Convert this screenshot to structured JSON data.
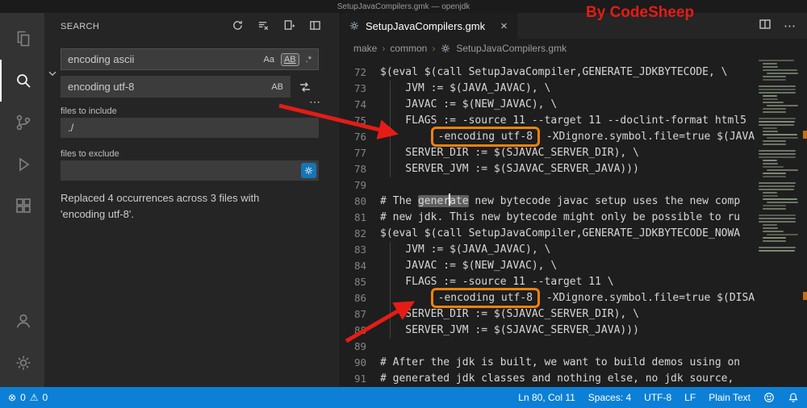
{
  "colors": {
    "statusbar_blue": "#0c80d7",
    "annotation_orange": "#ec820e",
    "annotation_red": "#e51c16",
    "activity_bar_bg": "#333333",
    "sidebar_bg": "#252526",
    "editor_bg": "#1e1e1e",
    "accent_blue": "#1476b5"
  },
  "glyphs": {
    "match_case": "Aa",
    "whole_word": "AB",
    "regex": ".*",
    "preserve_case": "AB",
    "more": "⋯",
    "breadcrumb_sep": "›",
    "close": "×",
    "errors_icon": "⊗",
    "warnings_icon": "⚠"
  },
  "title_bar": {
    "title": "SetupJavaCompilers.gmk — openjdk",
    "watermark": "By CodeSheep"
  },
  "activity_bar": {
    "items": [
      "explorer",
      "search",
      "source-control",
      "run-and-debug",
      "extensions"
    ],
    "active": "search",
    "bottom_items": [
      "account",
      "settings"
    ]
  },
  "search_panel": {
    "title": "SEARCH",
    "header_icons": [
      "refresh",
      "clear-search-results",
      "open-new-search-editor",
      "open-search-in-editor"
    ],
    "search": {
      "value": "encoding ascii"
    },
    "replace": {
      "value": "encoding utf-8"
    },
    "files_to_include": {
      "label": "files to include",
      "value": "./"
    },
    "files_to_exclude": {
      "label": "files to exclude",
      "value": ""
    },
    "message": "Replaced 4 occurrences across 3 files with 'encoding utf-8'."
  },
  "editor": {
    "tab": {
      "label": "SetupJavaCompilers.gmk"
    },
    "breadcrumbs": [
      "make",
      "common",
      "SetupJavaCompilers.gmk"
    ],
    "code": {
      "lines": [
        {
          "n": 72,
          "t": "$(eval $(call SetupJavaCompiler,GENERATE_JDKBYTECODE, \\"
        },
        {
          "n": 73,
          "t": "    JVM := $(JAVA_JAVAC), \\",
          "guide": true
        },
        {
          "n": 74,
          "t": "    JAVAC := $(NEW_JAVAC), \\",
          "guide": true
        },
        {
          "n": 75,
          "t": "    FLAGS := -source 11 --target 11 --doclint-format html5",
          "guide": true
        },
        {
          "n": 76,
          "pre": "        ",
          "box": "-encoding utf-8",
          "post": " -XDignore.symbol.file=true $(JAVA",
          "guide": true
        },
        {
          "n": 77,
          "t": "    SERVER_DIR := $(SJAVAC_SERVER_DIR), \\",
          "guide": true
        },
        {
          "n": 78,
          "t": "    SERVER_JVM := $(SJAVAC_SERVER_JAVA)))",
          "guide": true
        },
        {
          "n": 79,
          "t": ""
        },
        {
          "n": 80,
          "pre": "# The ",
          "hl": "generate",
          "caret": 5,
          "post": " new bytecode javac setup uses the new comp"
        },
        {
          "n": 81,
          "t": "# new jdk. This new bytecode might only be possible to ru"
        },
        {
          "n": 82,
          "t": "$(eval $(call SetupJavaCompiler,GENERATE_JDKBYTECODE_NOWA"
        },
        {
          "n": 83,
          "t": "    JVM := $(JAVA_JAVAC), \\",
          "guide": true
        },
        {
          "n": 84,
          "t": "    JAVAC := $(NEW_JAVAC), \\",
          "guide": true
        },
        {
          "n": 85,
          "t": "    FLAGS := -source 11 --target 11 \\",
          "guide": true
        },
        {
          "n": 86,
          "pre": "        ",
          "box": "-encoding utf-8",
          "post": " -XDignore.symbol.file=true $(DISA",
          "guide": true
        },
        {
          "n": 87,
          "t": "    SERVER_DIR := $(SJAVAC_SERVER_DIR), \\",
          "guide": true
        },
        {
          "n": 88,
          "t": "    SERVER_JVM := $(SJAVAC_SERVER_JAVA)))",
          "guide": true
        },
        {
          "n": 89,
          "t": ""
        },
        {
          "n": 90,
          "t": "# After the jdk is built, we want to build demos using on"
        },
        {
          "n": 91,
          "t": "# generated jdk classes and nothing else, no jdk source,"
        }
      ]
    }
  },
  "status_bar": {
    "errors": "0",
    "warnings": "0",
    "cursor": "Ln 80, Col 11",
    "indent": "Spaces: 4",
    "encoding": "UTF-8",
    "eol": "LF",
    "language": "Plain Text"
  }
}
